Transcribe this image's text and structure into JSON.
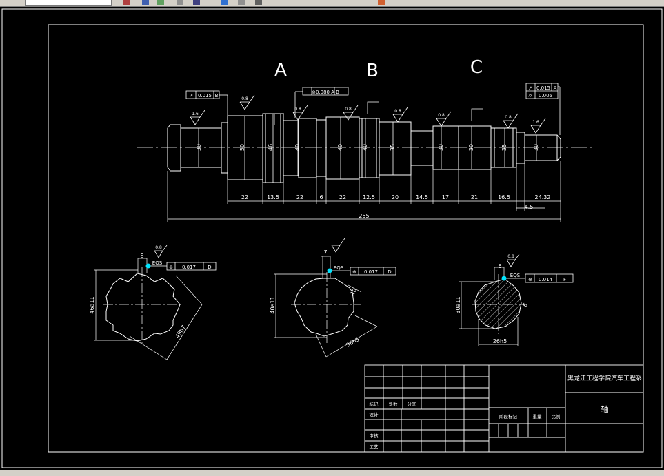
{
  "drawing": {
    "view_labels": {
      "a": "A",
      "b": "B",
      "c": "C"
    },
    "overall_length": "255",
    "segment_lengths": [
      "22",
      "13.5",
      "22",
      "6",
      "22",
      "12.5",
      "20",
      "14.5",
      "17",
      "21",
      "16.5",
      "24.32"
    ],
    "small_dim": "4.5",
    "diameters": [
      "30",
      "50",
      "46",
      "40",
      "40",
      "40",
      "35",
      "30",
      "30",
      "35",
      "30"
    ],
    "roughness": {
      "r16": "1.6",
      "r08": "0.8"
    },
    "tolerances": {
      "runout_left": "0.015",
      "runout_left_datum": "B",
      "coax": "⊚0.080 A-B",
      "runout_right": "0.015",
      "runout_right_datum": "A",
      "flatness_right": "0.005"
    },
    "section_a": {
      "width": "8",
      "dim_inner": "46a11",
      "dim_outer": "49h7",
      "symbol": "EQS",
      "tol": "0.017",
      "datum": "D"
    },
    "section_b": {
      "width": "7",
      "dim_inner": "40a11",
      "dim_outer": "36h5",
      "dim_angle": "10",
      "symbol": "EQS",
      "tol": "0.017",
      "datum": "D"
    },
    "section_c": {
      "width": "6",
      "dim_inner": "30a11",
      "dim_outer": "26h5",
      "dim_side": "6",
      "symbol": "EQS",
      "tol": "0.014",
      "datum": "F"
    },
    "title_block": {
      "school": "黑龙江工程学院汽车工程系",
      "part_name": "轴",
      "labels": {
        "mark": "标记",
        "count": "处数",
        "zone": "分区",
        "design": "设计",
        "review": "审核",
        "process": "工艺",
        "stage_mark": "阶段标记",
        "weight": "重量",
        "scale": "比例"
      }
    }
  }
}
